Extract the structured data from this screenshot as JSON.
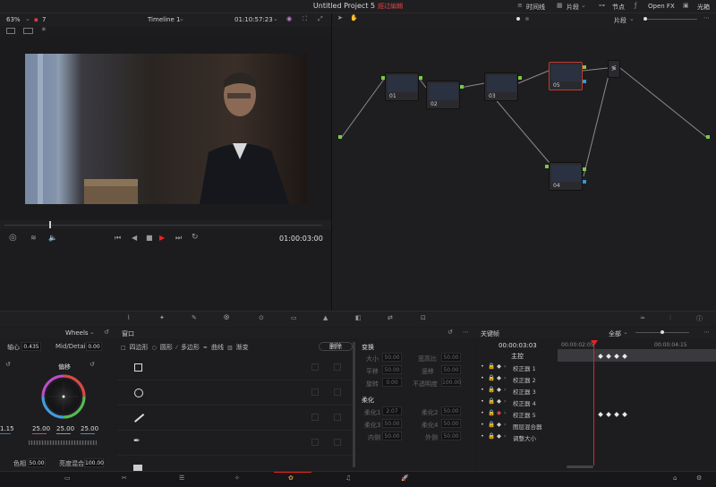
{
  "titlebar": {
    "project": "Untitled Project 5",
    "status": "經过編輯"
  },
  "viewer": {
    "zoom": "63%",
    "clip_count": "7",
    "timeline": "Timeline 1",
    "timecode": "01:10:57:23",
    "current_time": "01:00:03:00"
  },
  "node_editor": {
    "tabs": {
      "timeline": "时间线",
      "clip": "片段",
      "nodes": "节点",
      "openfx": "Open FX",
      "lightbox": "光箱"
    },
    "mode": "片段",
    "nodes": [
      {
        "id": "01",
        "label": "01"
      },
      {
        "id": "02",
        "label": "02"
      },
      {
        "id": "03",
        "label": "03"
      },
      {
        "id": "05",
        "label": "05"
      },
      {
        "id": "04",
        "label": "04"
      }
    ]
  },
  "panels": {
    "wheels": "Wheels",
    "window": "窗口",
    "keyframes": "关键帧"
  },
  "wheels": {
    "axis_label": "轴心",
    "axis_value": "0.435",
    "mode_label": "Mid/Detail",
    "mode_value": "0.00",
    "wheel_label": "偏移",
    "left_value": "1.15",
    "r": "25.00",
    "g": "25.00",
    "b": "25.00",
    "contrast_label": "色相",
    "contrast_value": "50.00",
    "lum_label": "亮度混合",
    "lum_value": "100.00"
  },
  "window_panel": {
    "tools": [
      "四边形",
      "圆形",
      "多边形",
      "曲线",
      "渐变"
    ],
    "delete": "删除"
  },
  "transform": {
    "section1": "变换",
    "size_label": "大小",
    "size": "50.00",
    "aspect_label": "宽高比",
    "aspect": "50.00",
    "pan_label": "平移",
    "pan": "50.00",
    "tilt_label": "竖移",
    "tilt": "50.00",
    "rotate_label": "旋转",
    "rotate": "0.00",
    "opacity_label": "不透明度",
    "opacity": "100.00",
    "section2": "柔化",
    "soft1_label": "柔化1",
    "soft1": "2.07",
    "soft2_label": "柔化2",
    "soft2": "50.00",
    "soft3_label": "柔化3",
    "soft3": "50.00",
    "soft4_label": "柔化4",
    "soft4": "50.00",
    "inside_label": "内侧",
    "inside": "50.00",
    "outside_label": "外侧",
    "outside": "50.00"
  },
  "keyframes": {
    "mode": "全部",
    "tc": "00:00:03:03",
    "ruler_a": "00:00:02:05",
    "ruler_b": "00:00:04:15",
    "master": "主控",
    "rows": [
      "校正器 1",
      "校正器 2",
      "校正器 3",
      "校正器 4",
      "校正器 5",
      "图层混合器",
      "调整大小"
    ]
  },
  "colors": {
    "accent": "#e24040",
    "pin_green": "#7ac943",
    "pin_blue": "#2f9bd9",
    "playhead": "#e02525"
  }
}
